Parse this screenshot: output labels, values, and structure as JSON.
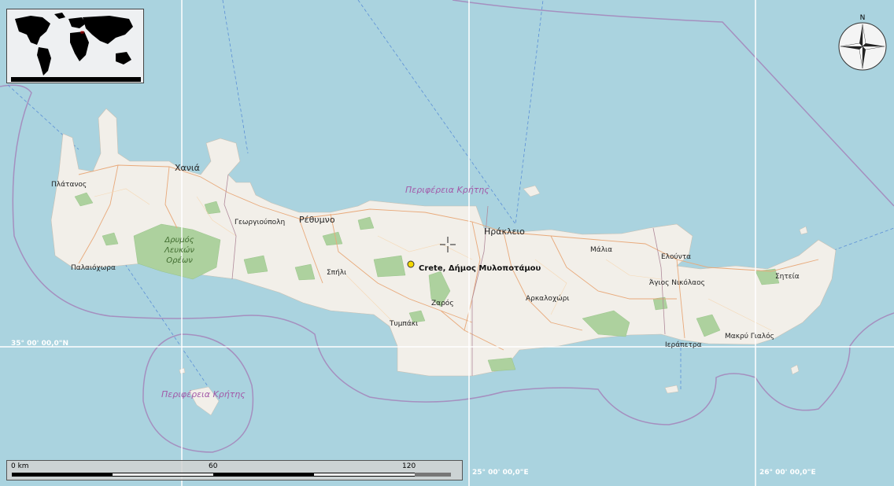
{
  "map": {
    "colors": {
      "sea": "#aad3df",
      "land": "#f2efe9",
      "forest": "#add19e",
      "boundary": "#a58fbf",
      "graticule": "#ffffff",
      "road": "#e8a97a"
    },
    "cities": [
      {
        "name": "Χανιά",
        "size": "m"
      },
      {
        "name": "Ρέθυμνο",
        "size": "m"
      },
      {
        "name": "Ηράκλειο",
        "size": "m"
      },
      {
        "name": "Πλάτανος",
        "size": "s"
      },
      {
        "name": "Γεωργιούπολη",
        "size": "s"
      },
      {
        "name": "Παλαιόχωρα",
        "size": "s"
      },
      {
        "name": "Σπήλι",
        "size": "s"
      },
      {
        "name": "Ζαρός",
        "size": "s"
      },
      {
        "name": "Τυμπάκι",
        "size": "s"
      },
      {
        "name": "Αρκαλοχώρι",
        "size": "s"
      },
      {
        "name": "Μάλια",
        "size": "s"
      },
      {
        "name": "Ελούντα",
        "size": "s"
      },
      {
        "name": "Άγιος Νικόλαος",
        "size": "s"
      },
      {
        "name": "Σητεία",
        "size": "s"
      },
      {
        "name": "Ιεράπετρα",
        "size": "s"
      },
      {
        "name": "Μακρύ Γιαλός",
        "size": "s"
      }
    ],
    "region_labels": [
      "Περιφέρεια Κρήτης",
      "Περιφέρεια Κρήτης"
    ],
    "forest_label": [
      "Δρυμός",
      "Λευκών",
      "Ορέων"
    ],
    "marker": {
      "label": "Crete, Δήμος Μυλοποτάμου",
      "color": "#f5d800"
    },
    "graticule": {
      "lat_label": "35° 00' 00,0\"N",
      "lon_labels": [
        "25° 00' 00,0\"E",
        "26° 00' 00,0\"E"
      ]
    }
  },
  "scale": {
    "labels": [
      "0 km",
      "60",
      "120"
    ]
  },
  "compass": {
    "north": "N"
  }
}
